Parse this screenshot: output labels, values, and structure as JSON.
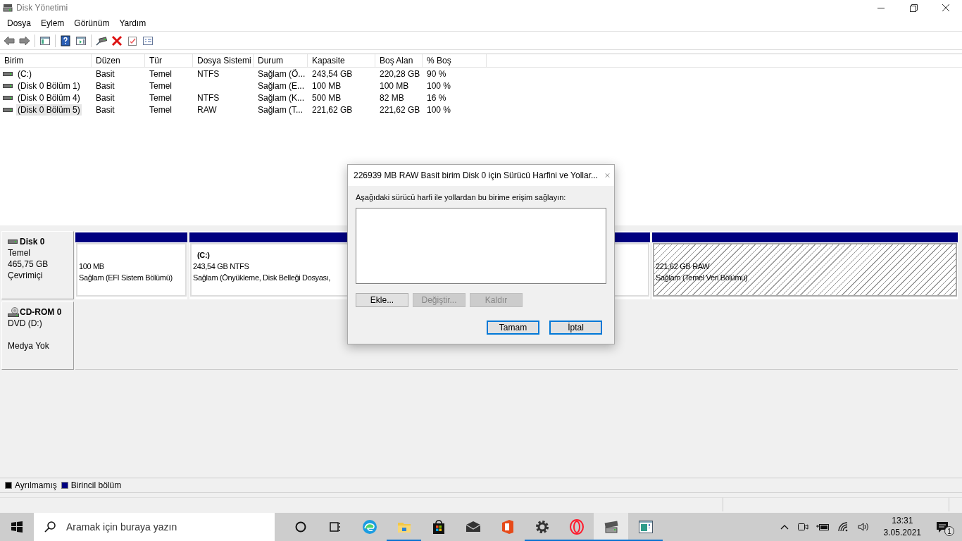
{
  "window": {
    "title": "Disk Yönetimi"
  },
  "menu": [
    "Dosya",
    "Eylem",
    "Görünüm",
    "Yardım"
  ],
  "table": {
    "columns": [
      "Birim",
      "Düzen",
      "Tür",
      "Dosya Sistemi",
      "Durum",
      "Kapasite",
      "Boş Alan",
      "% Boş"
    ],
    "rows": [
      {
        "volume": "(C:)",
        "layout": "Basit",
        "type": "Temel",
        "file_system": "NTFS",
        "status": "Sağlam (Ö...",
        "capacity": "243,54 GB",
        "free_space": "220,28 GB",
        "percent_free": "90 %",
        "selected": false
      },
      {
        "volume": "(Disk 0 Bölüm 1)",
        "layout": "Basit",
        "type": "Temel",
        "status": "Sağlam (E...",
        "capacity": "100 MB",
        "free_space": "100 MB",
        "percent_free": "100 %",
        "selected": false
      },
      {
        "volume": "(Disk 0 Bölüm 4)",
        "layout": "Basit",
        "type": "Temel",
        "file_system": "NTFS",
        "status": "Sağlam (K...",
        "capacity": "500 MB",
        "free_space": "82 MB",
        "percent_free": "16 %",
        "selected": false
      },
      {
        "volume": "(Disk 0 Bölüm 5)",
        "layout": "Basit",
        "type": "Temel",
        "file_system": "RAW",
        "status": "Sağlam (T...",
        "capacity": "221,62 GB",
        "free_space": "221,62 GB",
        "percent_free": "100 %",
        "selected": true
      }
    ]
  },
  "disks": [
    {
      "kind": "disk",
      "name": "Disk 0",
      "type": "Temel",
      "size": "465,75 GB",
      "status": "Çevrimiçi",
      "partitions": [
        {
          "size": "100 MB",
          "status": "Sağlam (EFI Sistem Bölümü)",
          "selected": false
        },
        {
          "title": "(C:)",
          "size": "243,54 GB NTFS",
          "status": "Sağlam (Önyükleme, Disk Belleği Dosyası,",
          "selected": false
        },
        {
          "size": "221,62 GB RAW",
          "status": "Sağlam (Temel Veri Bölümü)",
          "selected": true
        }
      ]
    },
    {
      "kind": "cdrom",
      "name": "CD-ROM 0",
      "type": "DVD (D:)",
      "status": "Medya Yok"
    }
  ],
  "legend": [
    {
      "label": "Ayrılmamış",
      "color": "#000000"
    },
    {
      "label": "Birincil bölüm",
      "color": "#000080"
    }
  ],
  "dialog": {
    "title": "226939 MB RAW Basit birim Disk 0 için Sürücü Harfini ve Yollar...",
    "instruction": "Aşağıdaki sürücü harfi ile yollardan bu birime erişim sağlayın:",
    "buttons": [
      {
        "label": "Ekle...",
        "disabled": false,
        "default": false
      },
      {
        "label": "Değiştir...",
        "disabled": true,
        "default": false
      },
      {
        "label": "Kaldır",
        "disabled": true,
        "default": false
      }
    ],
    "footer_buttons": [
      {
        "label": "Tamam",
        "disabled": false,
        "default": true
      },
      {
        "label": "İptal",
        "disabled": false,
        "default": true
      }
    ]
  },
  "taskbar": {
    "search": {
      "placeholder": "Aramak için buraya yazın"
    },
    "apps": [
      {
        "kind": "cortana",
        "running": false,
        "active": false
      },
      {
        "kind": "taskview",
        "running": false,
        "active": false
      },
      {
        "kind": "edge",
        "running": false,
        "active": false
      },
      {
        "kind": "explorer",
        "running": true,
        "active": false
      },
      {
        "kind": "store",
        "running": false,
        "active": false
      },
      {
        "kind": "mail",
        "running": false,
        "active": false
      },
      {
        "kind": "office",
        "running": false,
        "active": false
      },
      {
        "kind": "settings",
        "running": true,
        "active": false
      },
      {
        "kind": "opera",
        "running": true,
        "active": false
      },
      {
        "kind": "diskmgmt",
        "running": true,
        "active": true
      },
      {
        "kind": "window",
        "running": true,
        "active": false
      }
    ],
    "time": "13:31",
    "date": "3.05.2021",
    "notifications": "1"
  }
}
